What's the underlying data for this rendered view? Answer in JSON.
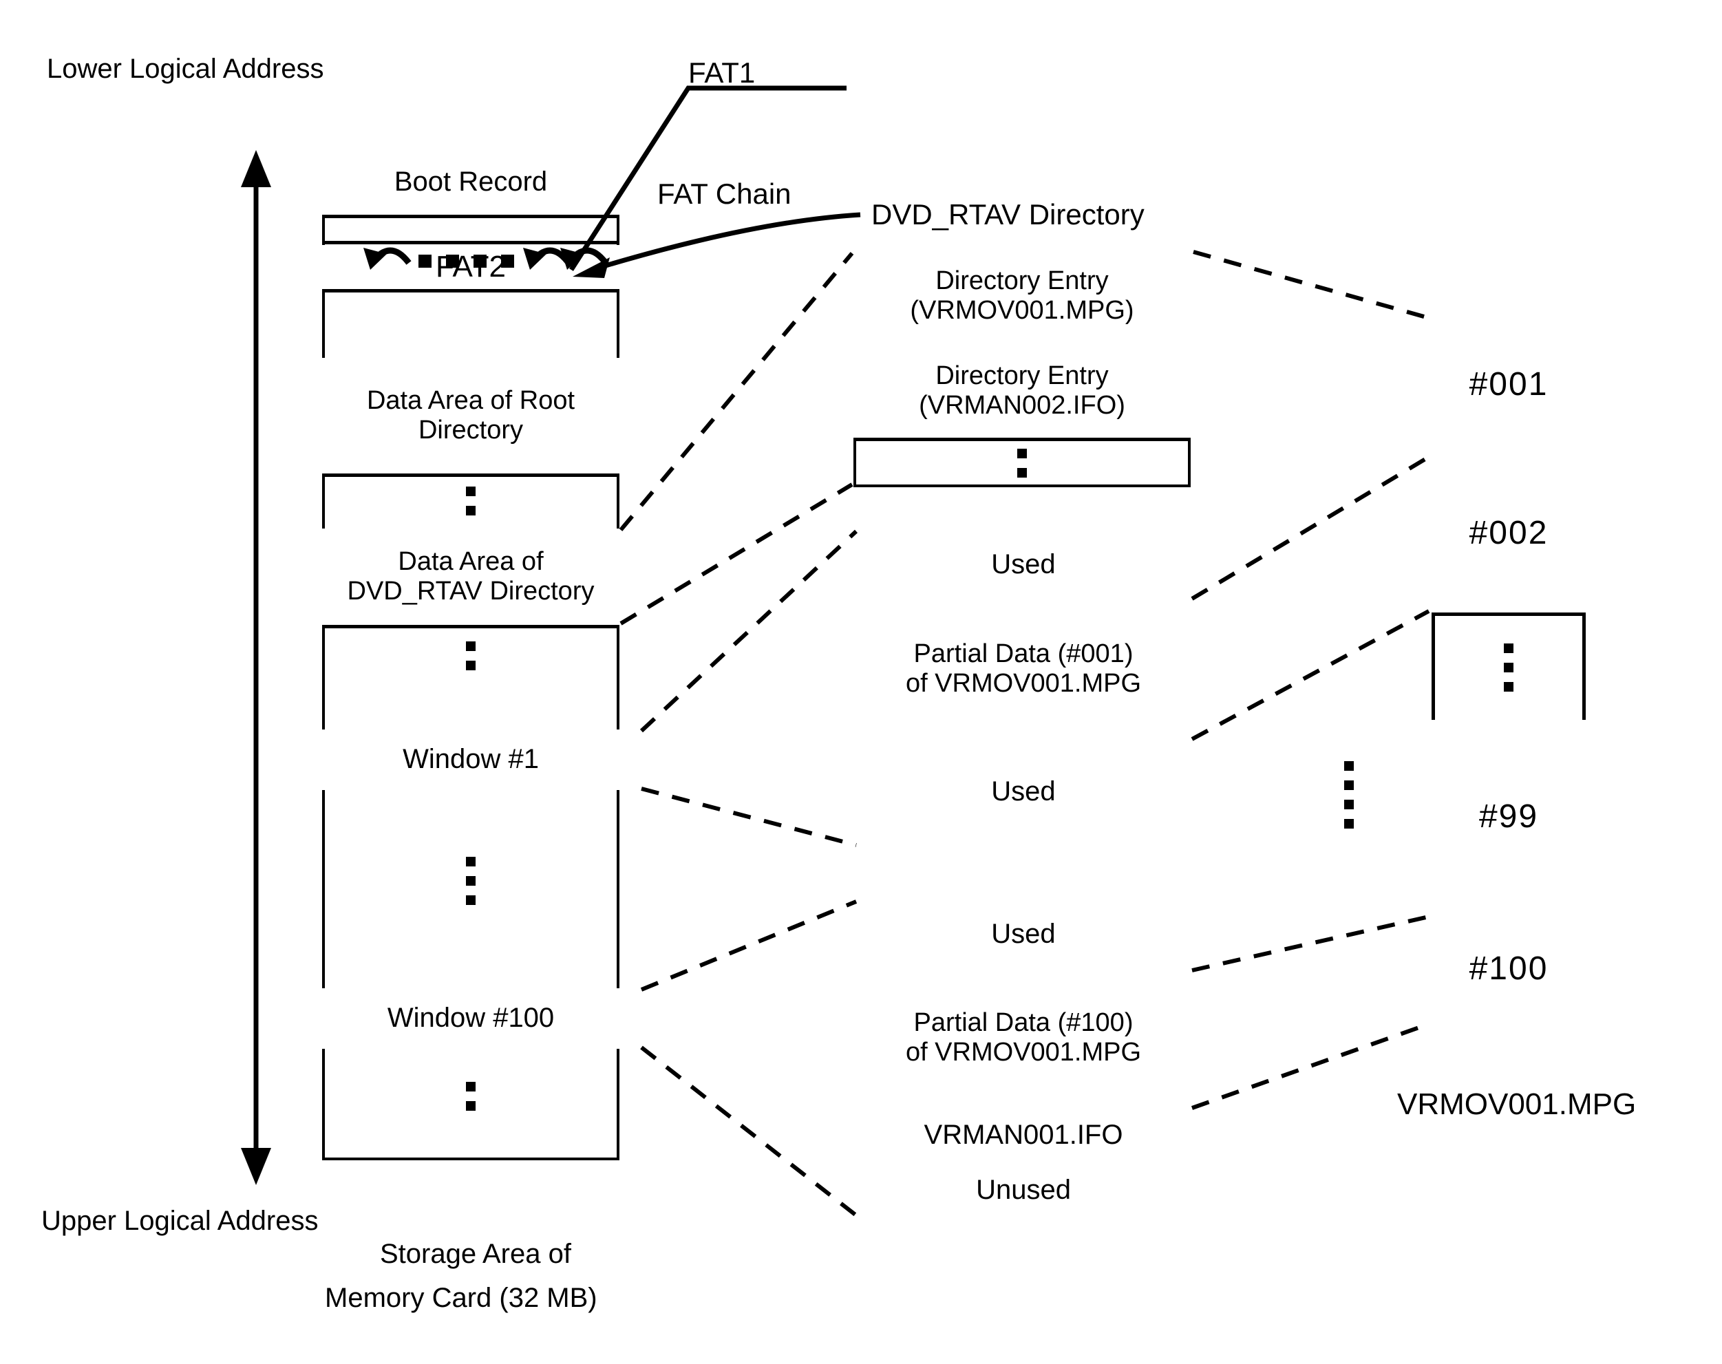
{
  "figure": {
    "axis_labels": {
      "top": "Lower Logical Address",
      "bottom": "Upper Logical Address"
    },
    "callouts": {
      "fat1": "FAT1",
      "fat_chain": "FAT Chain"
    },
    "memory_card": {
      "caption_line1": "Storage Area of",
      "caption_line2": "Memory Card (32 MB)",
      "rows": [
        {
          "label": "Boot Record",
          "kind": "text"
        },
        {
          "label": "",
          "kind": "blank"
        },
        {
          "label": "",
          "kind": "fat-chain-squiggle"
        },
        {
          "label": "FAT2",
          "kind": "text"
        },
        {
          "label": "",
          "kind": "blank"
        },
        {
          "label": "Data Area of Root\nDirectory",
          "kind": "text"
        },
        {
          "label": "",
          "kind": "ellipsis"
        },
        {
          "label": "Data Area of\nDVD_RTAV Directory",
          "kind": "text"
        },
        {
          "label": "",
          "kind": "ellipsis"
        },
        {
          "label": "Window #1",
          "kind": "window"
        },
        {
          "label": "",
          "kind": "ellipsis"
        },
        {
          "label": "Window #100",
          "kind": "window"
        },
        {
          "label": "",
          "kind": "ellipsis"
        }
      ]
    },
    "dvd_rtav_directory": {
      "title": "DVD_RTAV Directory",
      "entries": [
        {
          "label": "Directory Entry\n(VRMOV001.MPG)",
          "kind": "text"
        },
        {
          "label": "Directory Entry\n(VRMAN002.IFO)",
          "kind": "text"
        },
        {
          "label": "",
          "kind": "ellipsis"
        }
      ]
    },
    "window1_detail": {
      "rows": [
        {
          "label": "Used",
          "kind": "text"
        },
        {
          "label": "Partial Data (#001)\nof VRMOV001.MPG",
          "kind": "text"
        },
        {
          "label": "Used",
          "kind": "text"
        }
      ]
    },
    "window100_detail": {
      "rows": [
        {
          "label": "Used",
          "kind": "text"
        },
        {
          "label": "Partial Data (#100)\nof VRMOV001.MPG",
          "kind": "text"
        },
        {
          "label": "VRMAN001.IFO",
          "kind": "text"
        },
        {
          "label": "Unused",
          "kind": "text"
        }
      ]
    },
    "file_fragments": {
      "caption": "VRMOV001.MPG",
      "rows": [
        {
          "label": "#001",
          "kind": "text"
        },
        {
          "label": "#002",
          "kind": "text"
        },
        {
          "label": "",
          "kind": "ellipsis"
        },
        {
          "label": "#99",
          "kind": "text"
        },
        {
          "label": "#100",
          "kind": "text"
        }
      ]
    }
  },
  "colors": {
    "ink": "#000000",
    "paper": "#ffffff"
  }
}
